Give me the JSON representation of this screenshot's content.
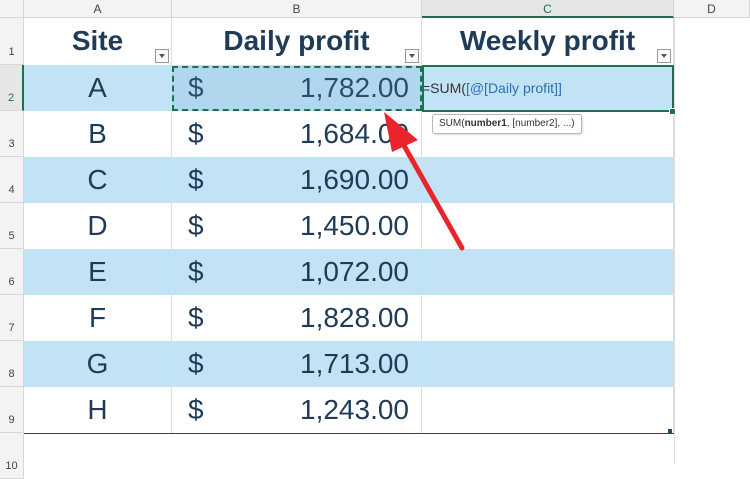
{
  "columns": [
    "A",
    "B",
    "C",
    "D"
  ],
  "row_numbers": [
    "1",
    "2",
    "3",
    "4",
    "5",
    "6",
    "7",
    "8",
    "9",
    "10"
  ],
  "headers": {
    "site": "Site",
    "daily": "Daily profit",
    "weekly": "Weekly profit"
  },
  "rows": [
    {
      "site": "A",
      "currency": "$",
      "amount": "1,782.00"
    },
    {
      "site": "B",
      "currency": "$",
      "amount": "1,684.00"
    },
    {
      "site": "C",
      "currency": "$",
      "amount": "1,690.00"
    },
    {
      "site": "D",
      "currency": "$",
      "amount": "1,450.00"
    },
    {
      "site": "E",
      "currency": "$",
      "amount": "1,072.00"
    },
    {
      "site": "F",
      "currency": "$",
      "amount": "1,828.00"
    },
    {
      "site": "G",
      "currency": "$",
      "amount": "1,713.00"
    },
    {
      "site": "H",
      "currency": "$",
      "amount": "1,243.00"
    }
  ],
  "formula": {
    "prefix": "=SUM(",
    "reference": "[@[Daily profit]]"
  },
  "tooltip": {
    "fn": "SUM(",
    "arg1": "number1",
    "rest": ", [number2], ...)"
  },
  "colors": {
    "band": "#c2e3f5",
    "header_text": "#1f3b57",
    "selection_border": "#1f6f52",
    "arrow": "#e8252a",
    "reference_blue": "#2f6db5"
  }
}
